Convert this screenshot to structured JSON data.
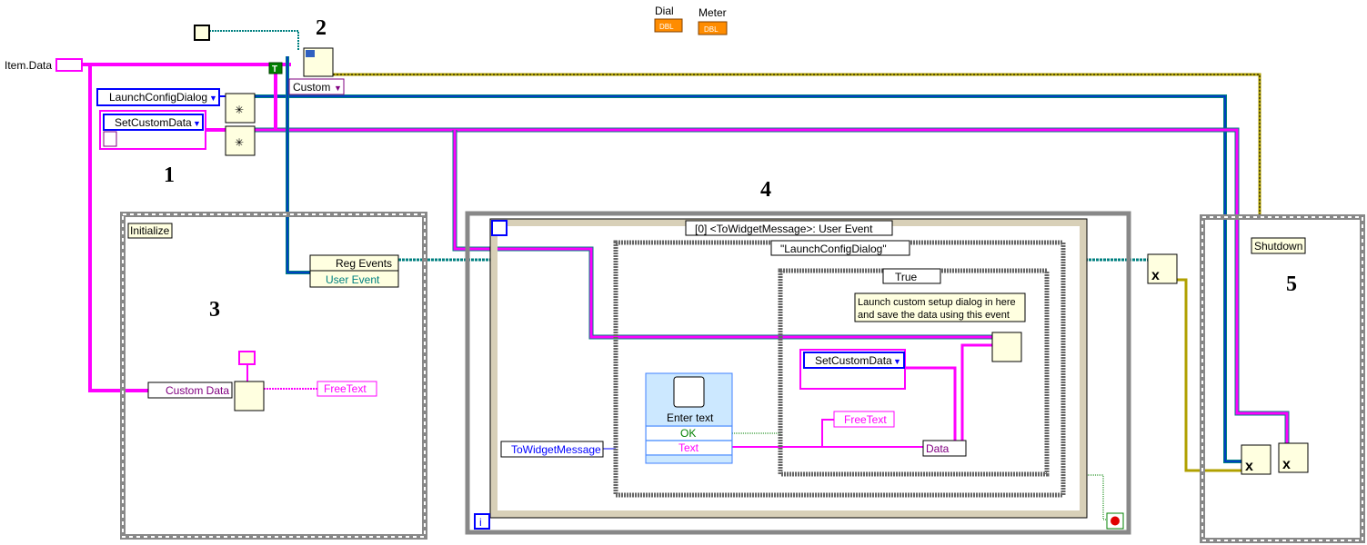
{
  "indicators": {
    "dial": "Dial",
    "meter": "Meter",
    "dbl": "DBL"
  },
  "item_data": "Item.Data",
  "section_numbers": [
    "1",
    "2",
    "3",
    "4",
    "5"
  ],
  "constants": {
    "launch_config": "LaunchConfigDialog",
    "set_custom_data": "SetCustomData",
    "custom": "Custom",
    "true_const": "T"
  },
  "initialize": {
    "label": "Initialize",
    "reg_events": "Reg Events",
    "user_event": "User Event",
    "custom_data": "Custom Data",
    "free_text": "FreeText"
  },
  "loop": {
    "event_label": "[0] <ToWidgetMessage>: User Event",
    "case_label": "\"LaunchConfigDialog\"",
    "inner_case_label": "True",
    "comment_line1": "Launch custom setup dialog in here",
    "comment_line2": "and save the data using this event",
    "set_custom_data": "SetCustomData",
    "free_text": "FreeText",
    "data": "Data",
    "enter_text": "Enter text",
    "ok": "OK",
    "text": "Text",
    "to_widget_message": "ToWidgetMessage",
    "iteration": "i"
  },
  "shutdown": {
    "label": "Shutdown"
  },
  "colors": {
    "string_wire": "#ff00ff",
    "refnum_wire": "#008080",
    "enum_blue": "#0000ff",
    "error_wire": "#b0a000",
    "frame_gray": "#808080",
    "node_fill": "#ffffe0"
  }
}
